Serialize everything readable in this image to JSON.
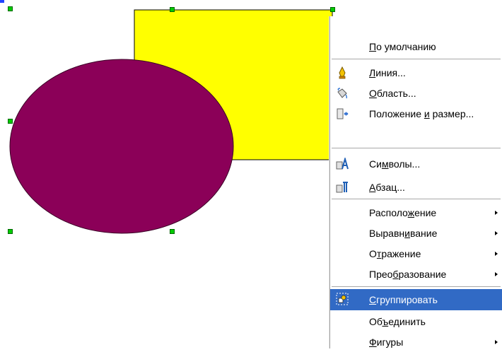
{
  "canvas": {
    "rectangle_fill": "#ffff00",
    "ellipse_fill": "#8b0058",
    "outline_color": "#000000",
    "handle_color": "#00cc00"
  },
  "context_menu": {
    "items": [
      {
        "pre": "",
        "u": "П",
        "post": "о умолчанию",
        "icon": ""
      },
      {
        "pre": "",
        "u": "Л",
        "post": "иния...",
        "icon": "line-pen-icon"
      },
      {
        "pre": "",
        "u": "О",
        "post": "бласть...",
        "icon": "area-bucket-icon"
      },
      {
        "pre": "Положение ",
        "u": "и",
        "post": " размер...",
        "icon": "position-size-icon"
      },
      {
        "pre": "Си",
        "u": "м",
        "post": "волы...",
        "icon": "character-icon"
      },
      {
        "pre": "",
        "u": "А",
        "post": "бзац...",
        "icon": "paragraph-icon"
      },
      {
        "pre": "Располо",
        "u": "ж",
        "post": "ение",
        "icon": ""
      },
      {
        "pre": "Выравн",
        "u": "и",
        "post": "вание",
        "icon": ""
      },
      {
        "pre": "О",
        "u": "т",
        "post": "ражение",
        "icon": ""
      },
      {
        "pre": "Прео",
        "u": "б",
        "post": "разование",
        "icon": ""
      },
      {
        "pre": "",
        "u": "С",
        "post": "группировать",
        "icon": "group-icon"
      },
      {
        "pre": "Об",
        "u": "ъ",
        "post": "единить",
        "icon": ""
      },
      {
        "pre": "",
        "u": "Ф",
        "post": "игуры",
        "icon": ""
      }
    ]
  }
}
